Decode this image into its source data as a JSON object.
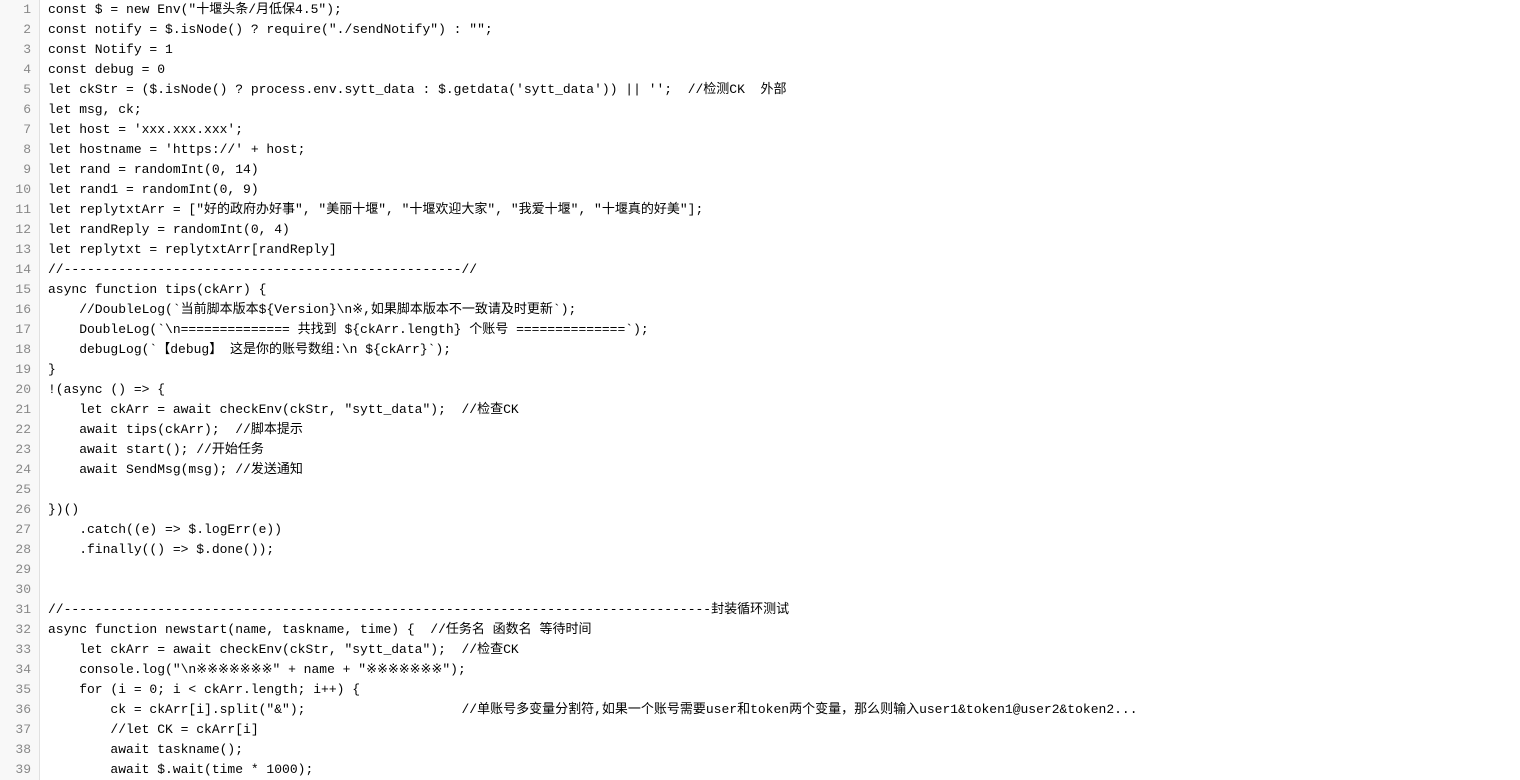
{
  "lines": [
    {
      "num": 1,
      "text": "const $ = new Env(\"十堰头条/月低保4.5\");"
    },
    {
      "num": 2,
      "text": "const notify = $.isNode() ? require(\"./sendNotify\") : \"\";"
    },
    {
      "num": 3,
      "text": "const Notify = 1"
    },
    {
      "num": 4,
      "text": "const debug = 0"
    },
    {
      "num": 5,
      "text": "let ckStr = ($.isNode() ? process.env.sytt_data : $.getdata('sytt_data')) || '';  //检测CK  外部"
    },
    {
      "num": 6,
      "text": "let msg, ck;"
    },
    {
      "num": 7,
      "text": "let host = 'xxx.xxx.xxx';"
    },
    {
      "num": 8,
      "text": "let hostname = 'https://' + host;"
    },
    {
      "num": 9,
      "text": "let rand = randomInt(0, 14)"
    },
    {
      "num": 10,
      "text": "let rand1 = randomInt(0, 9)"
    },
    {
      "num": 11,
      "text": "let replytxtArr = [\"好的政府办好事\", \"美丽十堰\", \"十堰欢迎大家\", \"我爱十堰\", \"十堰真的好美\"];"
    },
    {
      "num": 12,
      "text": "let randReply = randomInt(0, 4)"
    },
    {
      "num": 13,
      "text": "let replytxt = replytxtArr[randReply]"
    },
    {
      "num": 14,
      "text": "//---------------------------------------------------//"
    },
    {
      "num": 15,
      "text": "async function tips(ckArr) {"
    },
    {
      "num": 16,
      "text": "    //DoubleLog(`当前脚本版本${Version}\\n※,如果脚本版本不一致请及时更新`);"
    },
    {
      "num": 17,
      "text": "    DoubleLog(`\\n============== 共找到 ${ckArr.length} 个账号 ==============`);"
    },
    {
      "num": 18,
      "text": "    debugLog(`【debug】 这是你的账号数组:\\n ${ckArr}`);"
    },
    {
      "num": 19,
      "text": "}"
    },
    {
      "num": 20,
      "text": "!(async () => {"
    },
    {
      "num": 21,
      "text": "    let ckArr = await checkEnv(ckStr, \"sytt_data\");  //检查CK"
    },
    {
      "num": 22,
      "text": "    await tips(ckArr);  //脚本提示"
    },
    {
      "num": 23,
      "text": "    await start(); //开始任务"
    },
    {
      "num": 24,
      "text": "    await SendMsg(msg); //发送通知"
    },
    {
      "num": 25,
      "text": ""
    },
    {
      "num": 26,
      "text": "})()"
    },
    {
      "num": 27,
      "text": "    .catch((e) => $.logErr(e))"
    },
    {
      "num": 28,
      "text": "    .finally(() => $.done());"
    },
    {
      "num": 29,
      "text": ""
    },
    {
      "num": 30,
      "text": ""
    },
    {
      "num": 31,
      "text": "//-----------------------------------------------------------------------------------封装循环测试"
    },
    {
      "num": 32,
      "text": "async function newstart(name, taskname, time) {  //任务名 函数名 等待时间"
    },
    {
      "num": 33,
      "text": "    let ckArr = await checkEnv(ckStr, \"sytt_data\");  //检查CK"
    },
    {
      "num": 34,
      "text": "    console.log(\"\\n※※※※※※※\" + name + \"※※※※※※※\");"
    },
    {
      "num": 35,
      "text": "    for (i = 0; i < ckArr.length; i++) {"
    },
    {
      "num": 36,
      "text": "        ck = ckArr[i].split(\"&\");                    //单账号多变量分割符,如果一个账号需要user和token两个变量，那么则输入user1&token1@user2&token2..."
    },
    {
      "num": 37,
      "text": "        //let CK = ckArr[i]"
    },
    {
      "num": 38,
      "text": "        await taskname();"
    },
    {
      "num": 39,
      "text": "        await $.wait(time * 1000);"
    }
  ]
}
